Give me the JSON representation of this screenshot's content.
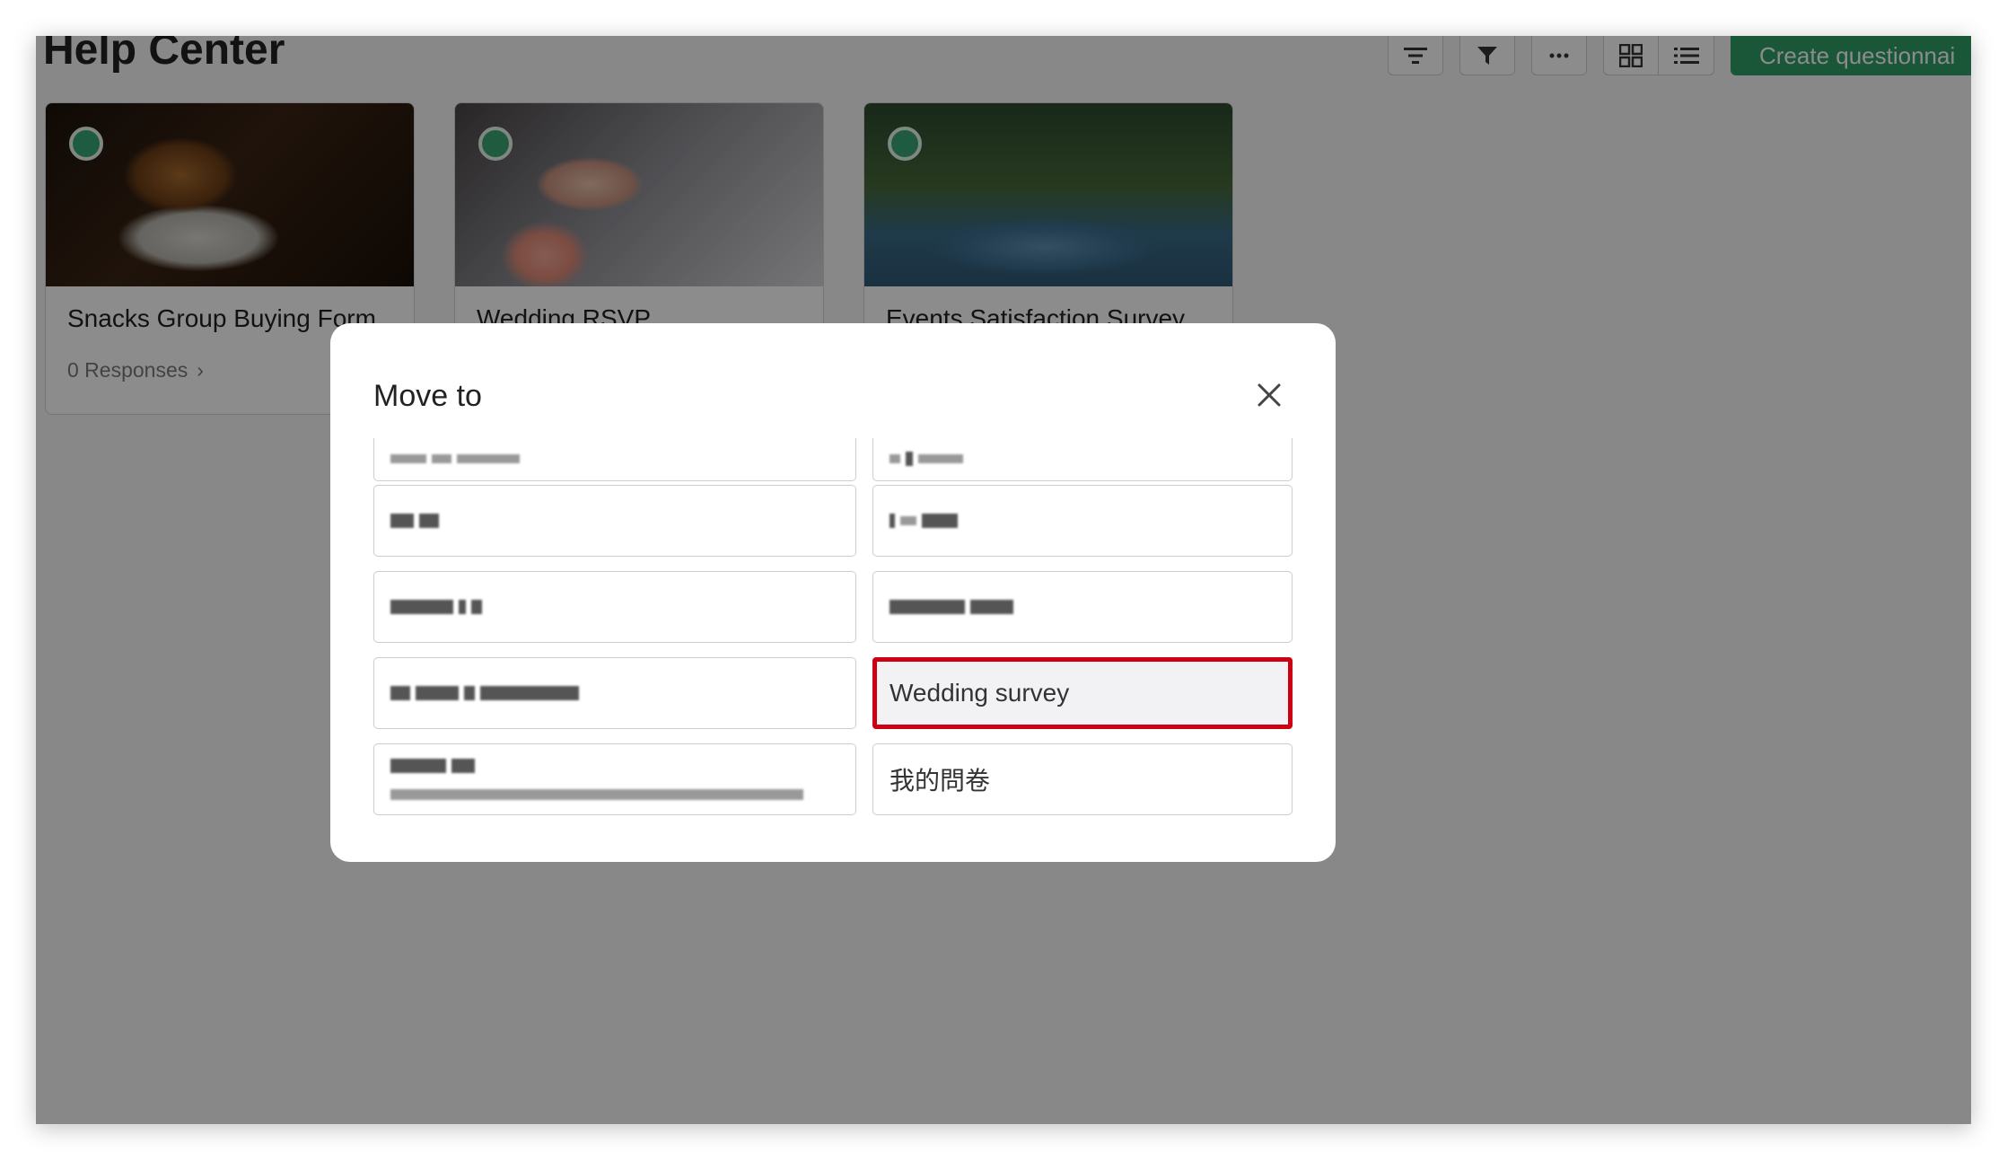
{
  "page": {
    "title": "Help Center"
  },
  "toolbar": {
    "sort_icon": "sort-lines-icon",
    "filter_icon": "funnel-icon",
    "more_icon": "ellipsis-icon",
    "grid_view_icon": "grid-view-icon",
    "list_view_icon": "list-view-icon",
    "create_label": "Create questionnai",
    "create_color": "#2f9e66"
  },
  "cards": [
    {
      "title": "Snacks Group Buying Form",
      "responses": "0 Responses"
    },
    {
      "title": "Wedding RSVP"
    },
    {
      "title": "Events Satisfaction Survey"
    }
  ],
  "modal": {
    "title": "Move to",
    "close_icon": "close-icon",
    "folders": [
      {
        "label": "",
        "blurred": true
      },
      {
        "label": "",
        "blurred": true
      },
      {
        "label": "",
        "blurred": true
      },
      {
        "label": "",
        "blurred": true
      },
      {
        "label": "",
        "blurred": true
      },
      {
        "label": "",
        "blurred": true
      },
      {
        "label": "",
        "blurred": true
      },
      {
        "label": "Wedding survey",
        "selected": true
      },
      {
        "label": "",
        "blurred": true
      },
      {
        "label": "我的問卷"
      }
    ],
    "highlight_color": "#cc0012"
  }
}
